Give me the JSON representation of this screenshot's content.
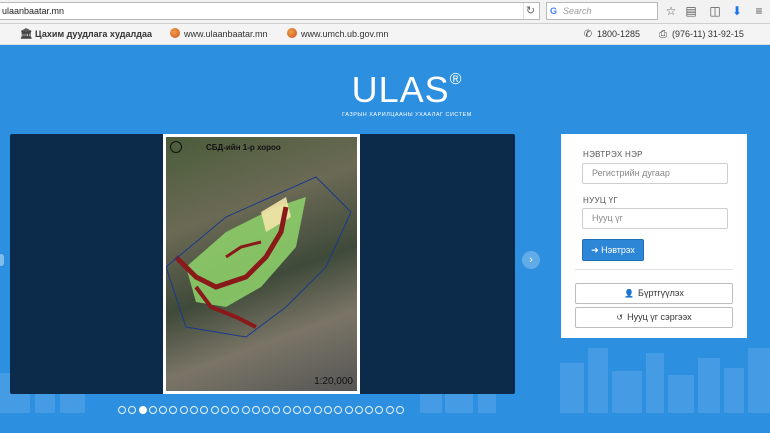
{
  "browser": {
    "url": "ulaanbaatar.mn",
    "search_placeholder": "Search",
    "search_engine_glyph": "G"
  },
  "info_bar": {
    "ecommerce_label": "Цахим дуудлага худалдаа",
    "site1": "www.ulaanbaatar.mn",
    "site2": "www.umch.ub.gov.mn",
    "phone": "1800-1285",
    "fax": "(976-11) 31-92-15"
  },
  "logo": {
    "title": "ULAS",
    "registered": "®",
    "subtitle": "ГАЗРЫН ХАРИЛЦААНЫ УХААЛАГ СИСТЕМ"
  },
  "slider": {
    "map_title": "СБД-ийн 1-р хороо",
    "map_scale": "1:20,000",
    "dots_count": 28,
    "active_dot": 2
  },
  "login": {
    "username_label": "НЭВТРЭХ НЭР",
    "username_placeholder": "Регистрийн дугаар",
    "password_label": "НУУЦ ҮГ",
    "password_placeholder": "Нууц үг",
    "login_button": "Нэвтрэх",
    "register_button": "Бүртгүүлэх",
    "reset_button": "Нууц үг сэргээх"
  },
  "colors": {
    "background": "#2d8fe0",
    "accent_button": "#2d86d6",
    "slider_bg": "#0c2b4a"
  }
}
